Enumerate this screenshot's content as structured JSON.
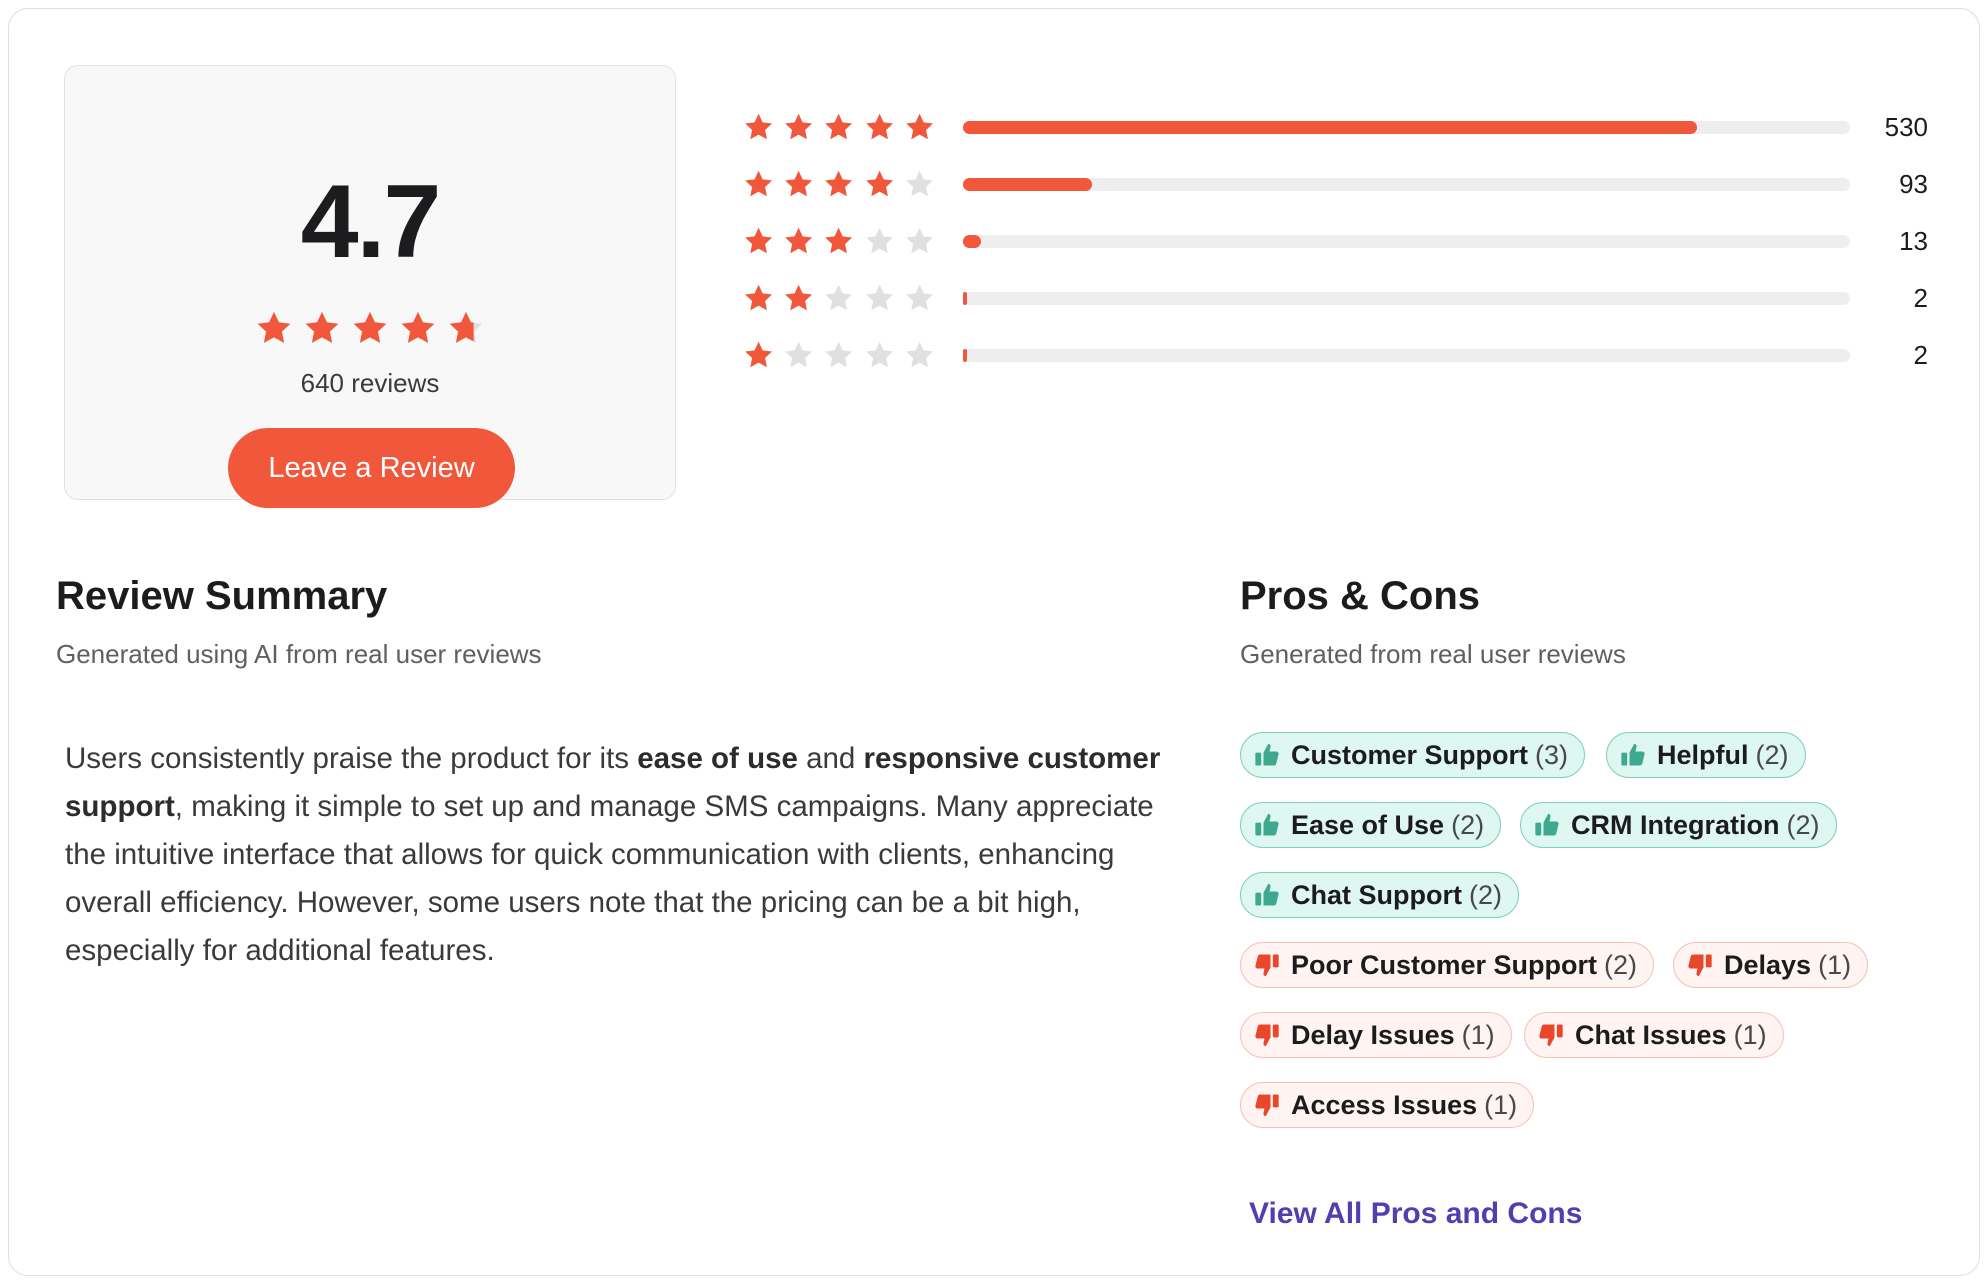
{
  "rating": {
    "value": "4.7",
    "stars": 4.7,
    "review_count": "640 reviews",
    "leave_review_label": "Leave a Review"
  },
  "distribution": [
    {
      "stars": 5,
      "count": "530",
      "fraction": 0.828
    },
    {
      "stars": 4,
      "count": "93",
      "fraction": 0.145
    },
    {
      "stars": 3,
      "count": "13",
      "fraction": 0.02
    },
    {
      "stars": 2,
      "count": "2",
      "fraction": 0.003
    },
    {
      "stars": 1,
      "count": "2",
      "fraction": 0.003
    }
  ],
  "summary": {
    "title": "Review Summary",
    "subtitle": "Generated using AI from real user reviews",
    "text_parts": [
      {
        "text": "Users consistently praise the product for its ",
        "bold": false
      },
      {
        "text": "ease of use",
        "bold": true
      },
      {
        "text": " and ",
        "bold": false
      },
      {
        "text": "responsive customer support",
        "bold": true
      },
      {
        "text": ", making it simple to set up and manage SMS campaigns. Many appreciate the intuitive interface that allows for quick communication with clients, enhancing overall efficiency. However, some users note that the pricing can be a bit high, especially for additional features.",
        "bold": false
      }
    ]
  },
  "pros_cons": {
    "title": "Pros & Cons",
    "subtitle": "Generated from real user reviews",
    "pros": [
      {
        "label": "Customer Support",
        "count": "(3)"
      },
      {
        "label": "Helpful",
        "count": "(2)"
      },
      {
        "label": "Ease of Use",
        "count": "(2)"
      },
      {
        "label": "CRM Integration",
        "count": "(2)"
      },
      {
        "label": "Chat Support",
        "count": "(2)"
      }
    ],
    "cons": [
      {
        "label": "Poor Customer Support",
        "count": "(2)"
      },
      {
        "label": "Delays",
        "count": "(1)"
      },
      {
        "label": "Delay Issues",
        "count": "(1)"
      },
      {
        "label": "Chat Issues",
        "count": "(1)"
      },
      {
        "label": "Access Issues",
        "count": "(1)"
      }
    ],
    "view_all_label": "View All Pros and Cons"
  },
  "colors": {
    "accent": "#f0573b",
    "star_empty": "#e0e0e0",
    "pro_icon": "#3fa98f",
    "con_icon": "#e8472c",
    "link": "#4f3fb0"
  },
  "icons": {
    "star": "star-icon",
    "pro": "thumbs-up-icon",
    "con": "thumbs-down-icon"
  }
}
